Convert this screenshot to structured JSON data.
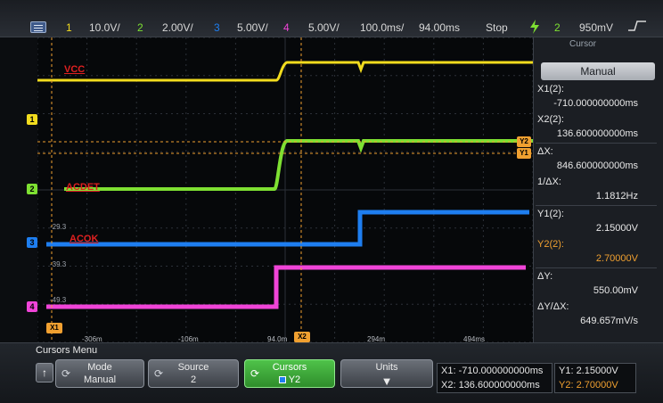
{
  "topbar": {
    "ch1_num": "1",
    "ch1_scale": "10.0V/",
    "ch2_num": "2",
    "ch2_scale": "2.00V/",
    "ch3_num": "3",
    "ch3_scale": "5.00V/",
    "ch4_num": "4",
    "ch4_scale": "5.00V/",
    "timebase": "100.0ms/",
    "delay": "94.00ms",
    "run_state": "Stop",
    "trigger_source": "2",
    "trigger_level": "950mV"
  },
  "colors": {
    "ch1": "#f2dc1e",
    "ch2": "#7ee032",
    "ch3": "#1e7ef0",
    "ch4": "#f044d8",
    "cursor": "#f0a030",
    "background": "#06080a",
    "grid": "#2c3038"
  },
  "labels": {
    "vcc": "VCC",
    "acdet": "ACDET",
    "acok": "ACOK"
  },
  "markers": {
    "ch1": "1",
    "ch2": "2",
    "ch3": "3",
    "ch4": "4",
    "x1": "X1",
    "x2": "X2",
    "y2": "Y2",
    "y1": "Y1"
  },
  "scale_labels": [
    "-29.3",
    "-39.3",
    "-49.3"
  ],
  "x_axis_labels": [
    "-306m",
    "-106m",
    "94.0m",
    "294m",
    "494ms"
  ],
  "cursor_panel": {
    "title": "Cursor",
    "mode": "Manual",
    "x1_label": "X1(2):",
    "x1_value": "-710.000000000ms",
    "x2_label": "X2(2):",
    "x2_value": "136.600000000ms",
    "dx_label": "ΔX:",
    "dx_value": "846.600000000ms",
    "inv_dx_label": "1/ΔX:",
    "inv_dx_value": "1.1812Hz",
    "y1_label": "Y1(2):",
    "y1_value": "2.15000V",
    "y2_label": "Y2(2):",
    "y2_value": "2.70000V",
    "dy_label": "ΔY:",
    "dy_value": "550.00mV",
    "dydx_label": "ΔY/ΔX:",
    "dydx_value": "649.657mV/s"
  },
  "bottom_menu": {
    "title": "Cursors Menu",
    "mode_label": "Mode",
    "mode_value": "Manual",
    "source_label": "Source",
    "source_value": "2",
    "cursors_label": "Cursors",
    "cursors_value": "Y2",
    "units_label": "Units",
    "readout_x1": "X1: -710.000000000ms",
    "readout_x2": "X2: 136.600000000ms",
    "readout_y1": "Y1: 2.15000V",
    "readout_y2": "Y2: 2.70000V"
  },
  "icons": {
    "menu": "menu-icon",
    "trigger": "lightning-icon",
    "cursor_knob": "rotary-knob-icon",
    "units_arrow": "down-arrow-icon",
    "up": "up-arrow-icon"
  }
}
